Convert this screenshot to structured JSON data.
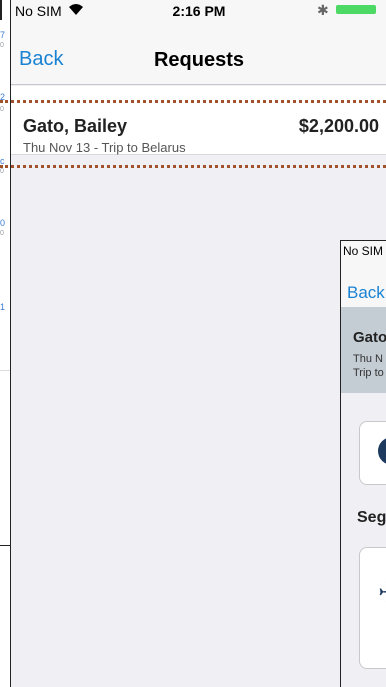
{
  "status": {
    "carrier": "No SIM",
    "time": "2:16 PM"
  },
  "nav": {
    "back": "Back",
    "title": "Requests"
  },
  "request": {
    "name": "Gato, Bailey",
    "amount": "$2,200.00",
    "detail": "Thu Nov 13 - Trip to Belarus"
  },
  "bg_strip": {
    "labels": [
      "7",
      "0",
      "2",
      "0",
      "c",
      "0",
      "0",
      "0",
      "1"
    ]
  },
  "overlay_phone": {
    "carrier": "No SIM",
    "back": "Back",
    "name": "Gato",
    "line1": "Thu N",
    "line2": "Trip to",
    "section": "Segn",
    "icons": {
      "info": "info-icon",
      "plane": "plane-icon"
    }
  },
  "colors": {
    "accent": "#1a82d2",
    "dots": "#a0522d",
    "card": "#c4ccd4"
  }
}
